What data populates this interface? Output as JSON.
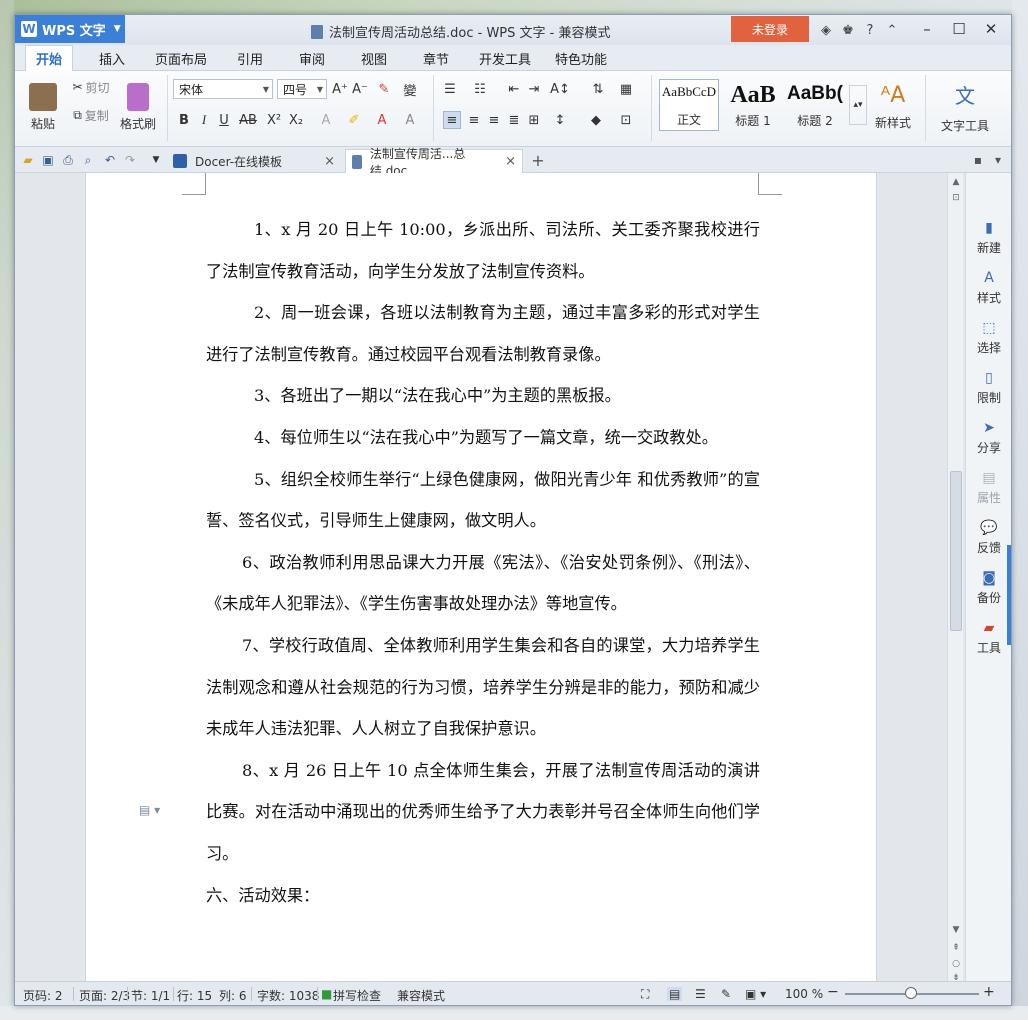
{
  "titlebar": {
    "app_name": "WPS 文字",
    "doc_title": "法制宣传周活动总结.doc - WPS 文字 - 兼容模式",
    "login_label": "未登录"
  },
  "menu": {
    "tabs": [
      "开始",
      "插入",
      "页面布局",
      "引用",
      "审阅",
      "视图",
      "章节",
      "开发工具",
      "特色功能"
    ]
  },
  "ribbon": {
    "paste": "粘贴",
    "cut": "剪切",
    "copy": "复制",
    "format_painter": "格式刷",
    "font_name": "宋体",
    "font_size": "四号",
    "styles": [
      {
        "preview": "AaBbCcD",
        "label": "正文"
      },
      {
        "preview": "AaB",
        "label": "标题 1"
      },
      {
        "preview": "AaBb(",
        "label": "标题 2"
      }
    ],
    "new_style": "新样式",
    "text_tools": "文字工具"
  },
  "doc_tabs": [
    {
      "label": "Docer-在线模板"
    },
    {
      "label": "法制宣传周活...总结.doc"
    }
  ],
  "document": {
    "paragraphs": [
      "1、x 月 20 日上午 10:00，乡派出所、司法所、关工委齐聚我校进行了法制宣传教育活动，向学生分发放了法制宣传资料。",
      "2、周一班会课，各班以法制教育为主题，通过丰富多彩的形式对学生进行了法制宣传教育。通过校园平台观看法制教育录像。",
      "3、各班出了一期以“法在我心中”为主题的黑板报。",
      "4、每位师生以“法在我心中”为题写了一篇文章，统一交政教处。",
      "5、组织全校师生举行“上绿色健康网，做阳光青少年  和优秀教师”的宣誓、签名仪式，引导师生上健康网，做文明人。",
      "6、政治教师利用思品课大力开展《宪法》、《治安处罚条例》、《刑法》、《未成年人犯罪法》、《学生伤害事故处理办法》等地宣传。",
      "7、学校行政值周、全体教师利用学生集会和各自的课堂，大力培养学生法制观念和遵从社会规范的行为习惯，培养学生分辨是非的能力，预防和减少未成年人违法犯罪、人人树立了自我保护意识。",
      "8、x 月 26 日上午 10 点全体师生集会，开展了法制宣传周活动的演讲比赛。对在活动中涌现出的优秀师生给予了大力表彰并号召全体师生向他们学习。",
      "六、活动效果："
    ]
  },
  "sidepanel": {
    "items": [
      {
        "label": "新建",
        "icon": "new-doc-icon",
        "enabled": true
      },
      {
        "label": "样式",
        "icon": "style-icon",
        "enabled": true
      },
      {
        "label": "选择",
        "icon": "select-icon",
        "enabled": true
      },
      {
        "label": "限制",
        "icon": "restrict-icon",
        "enabled": true
      },
      {
        "label": "分享",
        "icon": "share-icon",
        "enabled": true
      },
      {
        "label": "属性",
        "icon": "properties-icon",
        "enabled": false
      },
      {
        "label": "反馈",
        "icon": "feedback-icon",
        "enabled": true
      },
      {
        "label": "备份",
        "icon": "backup-icon",
        "enabled": true
      },
      {
        "label": "工具",
        "icon": "toolbox-icon",
        "enabled": true
      }
    ]
  },
  "statusbar": {
    "page_code": "页码: 2",
    "pages": "页面: 2/3",
    "section": "节: 1/1",
    "row": "行: 15",
    "col": "列: 6",
    "word_count": "字数: 1038",
    "spell_check": "拼写检查",
    "compat_mode": "兼容模式",
    "zoom": "100 %"
  },
  "colors": {
    "accent": "#3c7fd6",
    "login": "#e0623e"
  }
}
